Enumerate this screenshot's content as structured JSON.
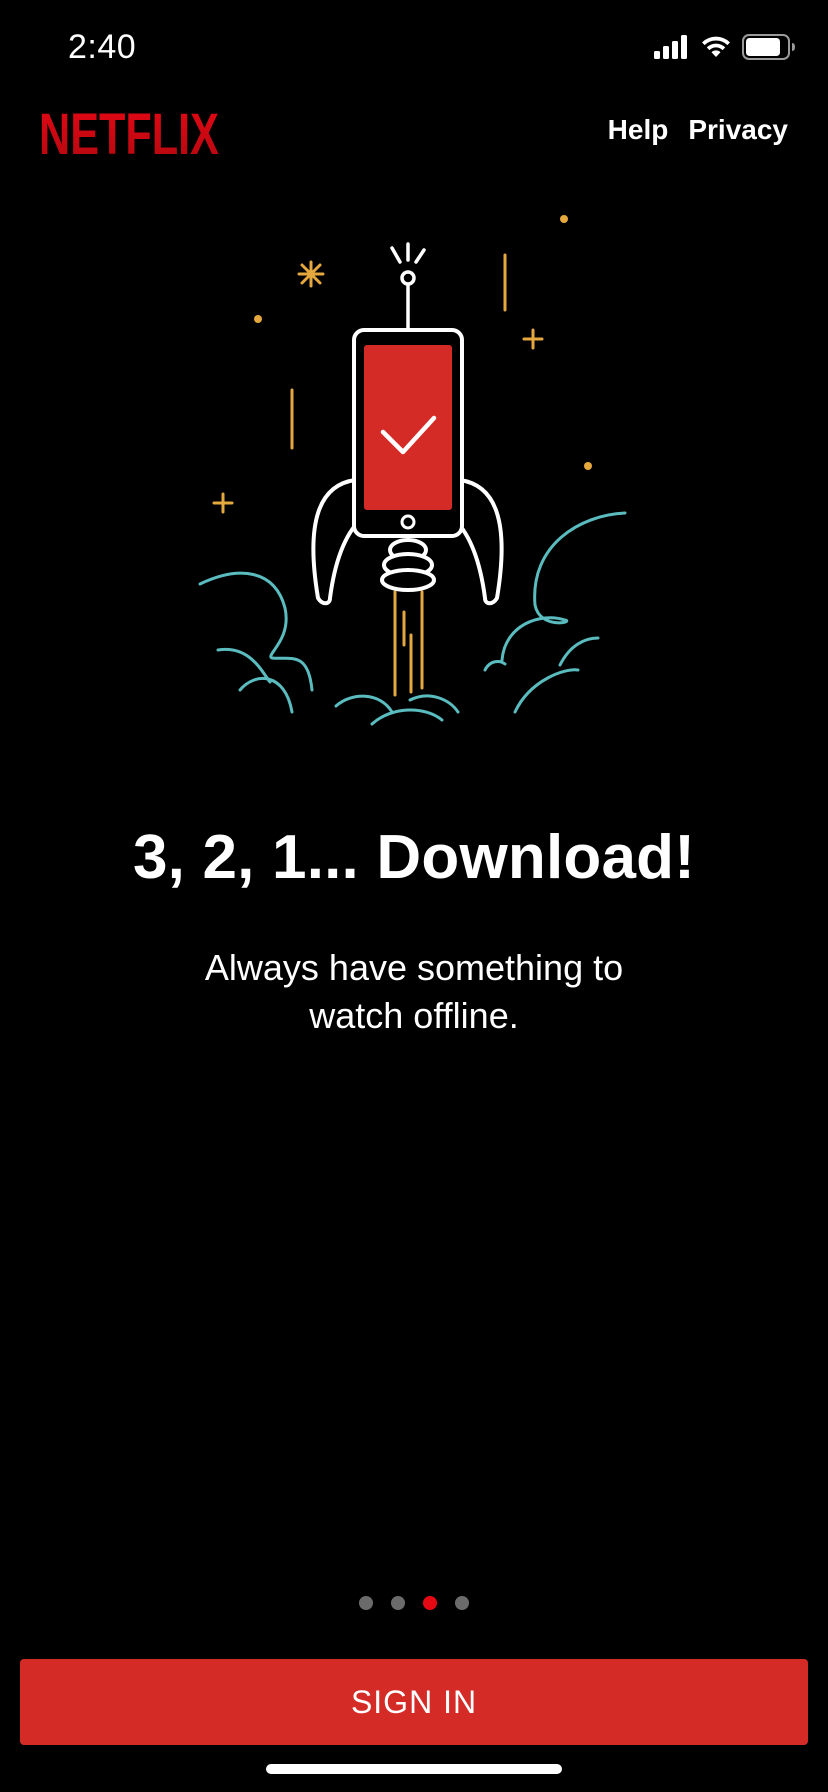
{
  "status_bar": {
    "time": "2:40",
    "icons": [
      "cellular-signal-icon",
      "wifi-icon",
      "battery-icon"
    ]
  },
  "header": {
    "logo_text": "NETFLIX",
    "links": [
      {
        "label": "Help"
      },
      {
        "label": "Privacy"
      }
    ]
  },
  "illustration": {
    "name": "rocket-phone-illustration",
    "colors": {
      "screen": "#d52b27",
      "outline": "#ffffff",
      "sparkle": "#e5a83f",
      "smoke": "#5bbcbf"
    }
  },
  "slide": {
    "headline": "3, 2, 1... Download!",
    "subtitle": "Always have something to watch offline."
  },
  "pager": {
    "total": 4,
    "active_index": 2
  },
  "cta": {
    "label": "SIGN IN"
  },
  "colors": {
    "background": "#000000",
    "brand_red": "#e50914",
    "button_red": "#d52b27",
    "inactive_dot": "#6b6b6b"
  }
}
